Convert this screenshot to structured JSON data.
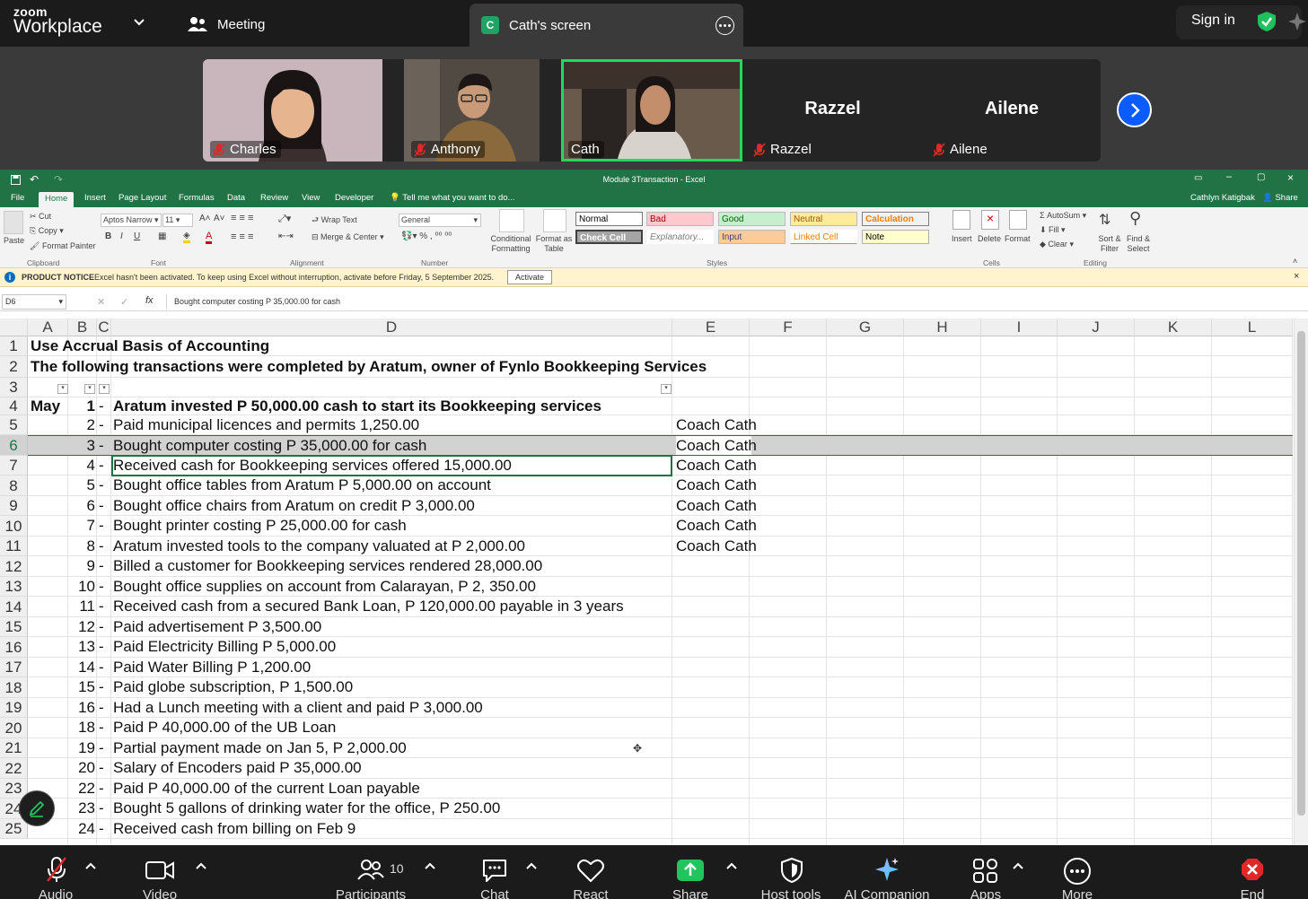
{
  "zoom": {
    "brand_small": "zoom",
    "brand_big": "Workplace",
    "meeting_label": "Meeting",
    "screen_tab": "Cath's screen",
    "screen_tab_initial": "C",
    "sign_in": "Sign in"
  },
  "participants": [
    {
      "name": "Charles",
      "video": true,
      "muted": true
    },
    {
      "name": "Anthony",
      "video": true,
      "muted": true
    },
    {
      "name": "Cath",
      "video": true,
      "muted": false,
      "active": true
    },
    {
      "name": "Razzel",
      "video": false,
      "muted": true
    },
    {
      "name": "Ailene",
      "video": false,
      "muted": true
    }
  ],
  "excel": {
    "title": "Module 3Transaction - Excel",
    "user": "Cathlyn Katigbak",
    "share": "Share",
    "tabs": [
      "File",
      "Home",
      "Insert",
      "Page Layout",
      "Formulas",
      "Data",
      "Review",
      "View",
      "Developer",
      "Tell me what you want to do..."
    ],
    "ribbon": {
      "paste": "Paste",
      "cut": "Cut",
      "copy": "Copy",
      "format_painter": "Format Painter",
      "clipboard": "Clipboard",
      "font_name": "Aptos Narrow",
      "font_size": "11",
      "font": "Font",
      "wrap_text": "Wrap Text",
      "merge_center": "Merge & Center",
      "alignment": "Alignment",
      "number_format": "General",
      "number": "Number",
      "cond_format": "Conditional Formatting",
      "format_table": "Format as Table",
      "styles": "Styles",
      "style_normal": "Normal",
      "style_bad": "Bad",
      "style_good": "Good",
      "style_neutral": "Neutral",
      "style_calc": "Calculation",
      "style_check": "Check Cell",
      "style_expl": "Explanatory...",
      "style_input": "Input",
      "style_linked": "Linked Cell",
      "style_note": "Note",
      "insert": "Insert",
      "delete": "Delete",
      "format": "Format",
      "cells": "Cells",
      "autosum": "AutoSum",
      "fill": "Fill",
      "clear": "Clear",
      "sort_filter": "Sort & Filter",
      "find_select": "Find & Select",
      "editing": "Editing"
    },
    "notice": {
      "title": "PRODUCT NOTICE",
      "text": "Excel hasn't been activated. To keep using Excel without interruption, activate before Friday, 5 September 2025.",
      "button": "Activate"
    },
    "name_box": "D6",
    "formula": "Bought computer costing P 35,000.00 for cash",
    "columns": [
      "A",
      "B",
      "C",
      "D",
      "E",
      "F",
      "G",
      "H",
      "I",
      "J",
      "K",
      "L"
    ],
    "rows": [
      {
        "n": "1",
        "a": "Use Accrual Basis of Accounting",
        "b": "",
        "d": "",
        "e": "",
        "bold": true,
        "span": true
      },
      {
        "n": "2",
        "a": "The following transactions were completed by Aratum, owner of Fynlo Bookkeeping Services",
        "b": "",
        "d": "",
        "e": "",
        "bold": true,
        "span": true
      },
      {
        "n": "3",
        "a": "",
        "b": "",
        "d": "",
        "e": "",
        "filters": true
      },
      {
        "n": "4",
        "a": "May",
        "b": "1",
        "d": "Aratum invested P 50,000.00 cash to start its Bookkeeping services",
        "e": "",
        "bold": true
      },
      {
        "n": "5",
        "a": "",
        "b": "2",
        "d": "Paid municipal licences and permits 1,250.00",
        "e": "Coach Cath"
      },
      {
        "n": "6",
        "a": "",
        "b": "3",
        "d": "Bought computer costing P 35,000.00 for cash",
        "e": "Coach Cath",
        "selected": true
      },
      {
        "n": "7",
        "a": "",
        "b": "4",
        "d": "Received cash for Bookkeeping services offered 15,000.00",
        "e": "Coach Cath"
      },
      {
        "n": "8",
        "a": "",
        "b": "5",
        "d": "Bought office tables from Aratum P 5,000.00 on account",
        "e": "Coach Cath"
      },
      {
        "n": "9",
        "a": "",
        "b": "6",
        "d": "Bought office chairs from Aratum on credit P 3,000.00",
        "e": "Coach Cath"
      },
      {
        "n": "10",
        "a": "",
        "b": "7",
        "d": "Bought printer costing P 25,000.00 for cash",
        "e": "Coach Cath"
      },
      {
        "n": "11",
        "a": "",
        "b": "8",
        "d": "Aratum invested tools to the company valuated at P 2,000.00",
        "e": "Coach Cath"
      },
      {
        "n": "12",
        "a": "",
        "b": "9",
        "d": "Billed a customer for Bookkeeping services rendered 28,000.00",
        "e": ""
      },
      {
        "n": "13",
        "a": "",
        "b": "10",
        "d": "Bought office supplies on account from Calarayan, P 2, 350.00",
        "e": ""
      },
      {
        "n": "14",
        "a": "",
        "b": "11",
        "d": "Received cash from a secured Bank Loan, P 120,000.00 payable in 3 years",
        "e": ""
      },
      {
        "n": "15",
        "a": "",
        "b": "12",
        "d": "Paid advertisement P 3,500.00",
        "e": ""
      },
      {
        "n": "16",
        "a": "",
        "b": "13",
        "d": "Paid Electricity Billing P 5,000.00",
        "e": ""
      },
      {
        "n": "17",
        "a": "",
        "b": "14",
        "d": "Paid Water Billing P 1,200.00",
        "e": ""
      },
      {
        "n": "18",
        "a": "",
        "b": "15",
        "d": "Paid globe subscription, P 1,500.00",
        "e": ""
      },
      {
        "n": "19",
        "a": "",
        "b": "16",
        "d": "Had a Lunch meeting with a client and paid P 3,000.00",
        "e": ""
      },
      {
        "n": "20",
        "a": "",
        "b": "18",
        "d": "Paid P 40,000.00 of the UB Loan",
        "e": ""
      },
      {
        "n": "21",
        "a": "",
        "b": "19",
        "d": "Partial payment made on Jan 5, P 2,000.00",
        "e": ""
      },
      {
        "n": "22",
        "a": "",
        "b": "20",
        "d": "Salary of Encoders paid P 35,000.00",
        "e": ""
      },
      {
        "n": "23",
        "a": "",
        "b": "22",
        "d": "Paid P 40,000.00 of the current Loan payable",
        "e": ""
      },
      {
        "n": "24",
        "a": "",
        "b": "23",
        "d": "Bought 5 gallons of drinking water for the office, P 250.00",
        "e": ""
      },
      {
        "n": "25",
        "a": "",
        "b": "24",
        "d": "Received cash from billing on Feb 9",
        "e": ""
      }
    ],
    "dash": "-"
  },
  "toolbar": [
    {
      "id": "audio",
      "label": "Audio",
      "icon": "mic-muted-icon"
    },
    {
      "id": "video",
      "label": "Video",
      "icon": "camera-icon"
    },
    {
      "id": "participants",
      "label": "Participants",
      "icon": "participants-icon",
      "count": "10"
    },
    {
      "id": "chat",
      "label": "Chat",
      "icon": "chat-icon"
    },
    {
      "id": "react",
      "label": "React",
      "icon": "heart-icon"
    },
    {
      "id": "share",
      "label": "Share",
      "icon": "share-icon"
    },
    {
      "id": "host",
      "label": "Host tools",
      "icon": "shield-icon"
    },
    {
      "id": "ai",
      "label": "AI Companion",
      "icon": "sparkle-icon"
    },
    {
      "id": "apps",
      "label": "Apps",
      "icon": "apps-icon"
    },
    {
      "id": "more",
      "label": "More",
      "icon": "more-icon"
    },
    {
      "id": "end",
      "label": "End",
      "icon": "end-icon"
    }
  ],
  "colors": {
    "excel_green": "#217346",
    "zoom_blue": "#0b5cff",
    "share_green": "#21c45d",
    "end_red": "#e02828",
    "active_tile": "#23d959"
  }
}
